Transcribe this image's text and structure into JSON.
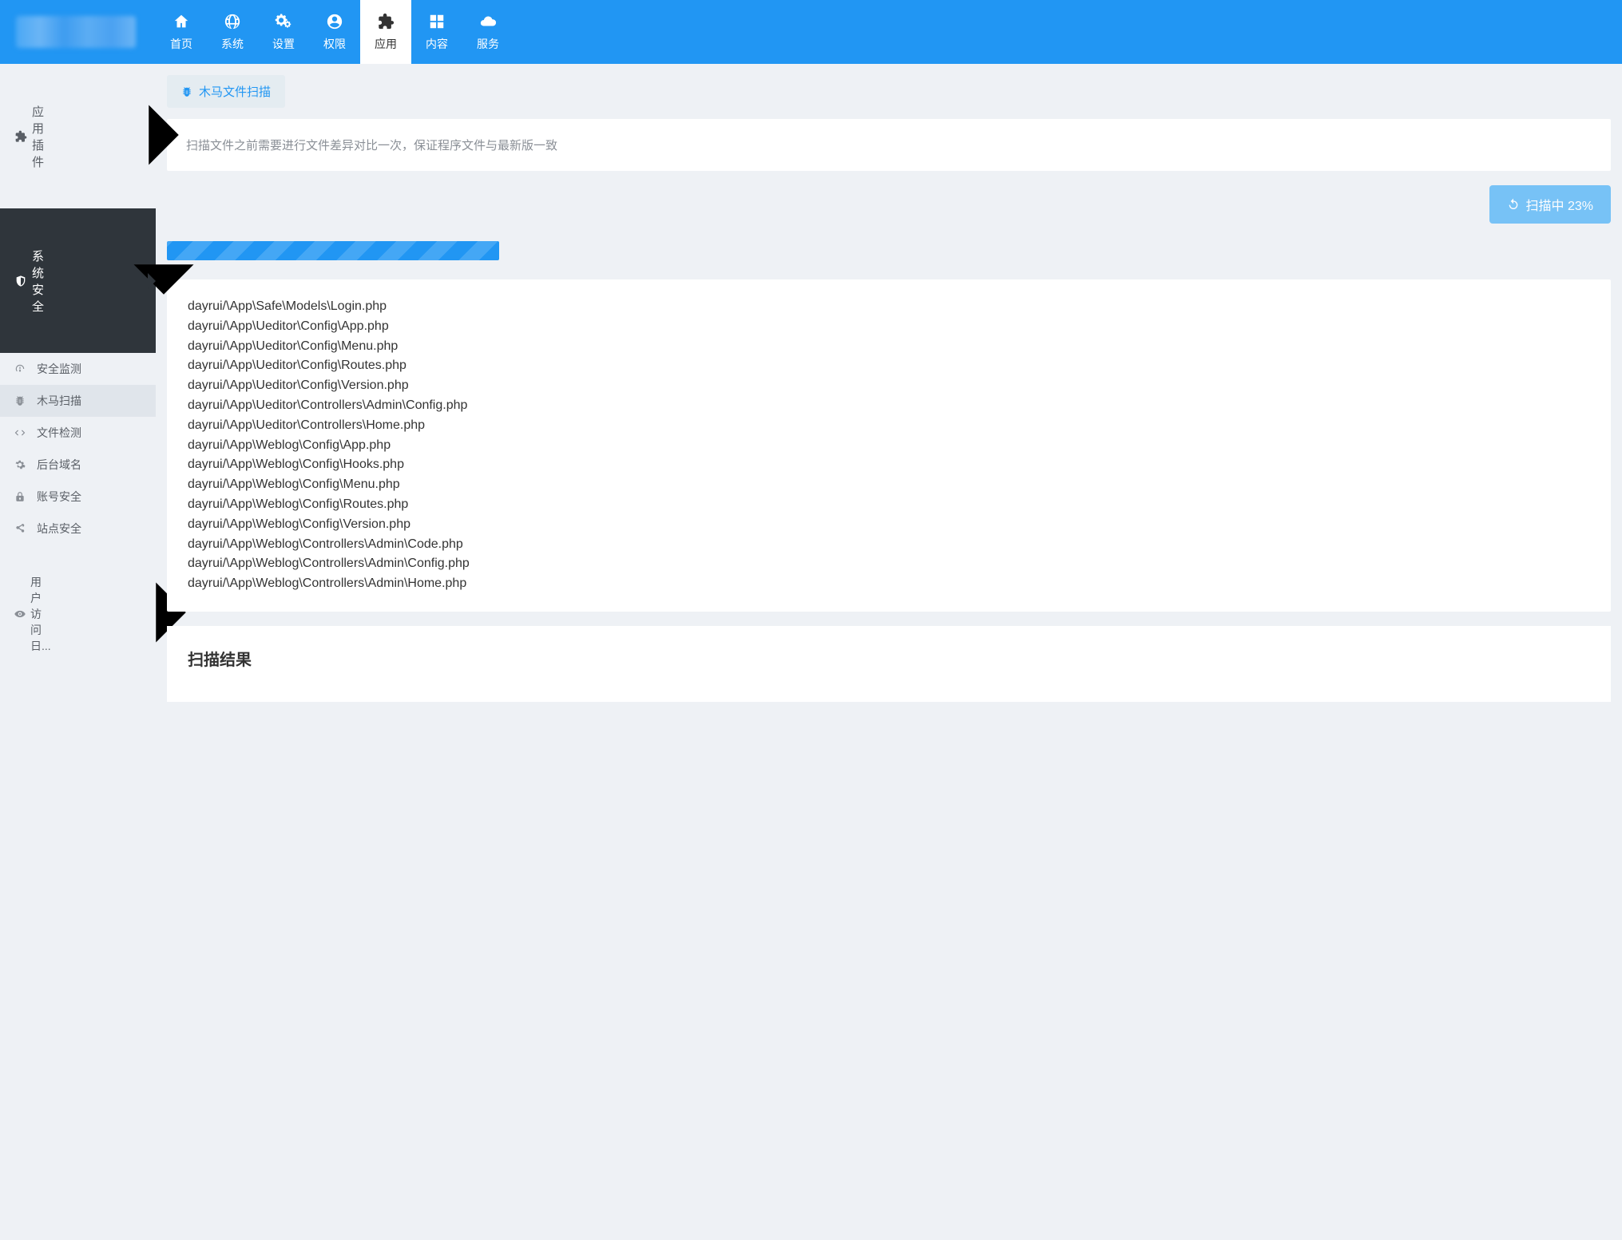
{
  "topnav": [
    {
      "label": "首页",
      "icon": "home"
    },
    {
      "label": "系统",
      "icon": "globe"
    },
    {
      "label": "设置",
      "icon": "gears"
    },
    {
      "label": "权限",
      "icon": "user-circle"
    },
    {
      "label": "应用",
      "icon": "puzzle",
      "active": true
    },
    {
      "label": "内容",
      "icon": "grid"
    },
    {
      "label": "服务",
      "icon": "cloud"
    }
  ],
  "sidebar": {
    "groups": [
      {
        "label": "应用插件",
        "icon": "puzzle",
        "chev": "right"
      },
      {
        "label": "系统安全",
        "icon": "shield",
        "chev": "down",
        "active": true
      }
    ],
    "subs": [
      {
        "label": "安全监测",
        "icon": "dashboard"
      },
      {
        "label": "木马扫描",
        "icon": "bug",
        "active": true
      },
      {
        "label": "文件检测",
        "icon": "code"
      },
      {
        "label": "后台域名",
        "icon": "gear"
      },
      {
        "label": "账号安全",
        "icon": "lock"
      },
      {
        "label": "站点安全",
        "icon": "share"
      },
      {
        "label": "用户访问日...",
        "icon": "eye",
        "chev": "right"
      }
    ]
  },
  "tab": {
    "label": "木马文件扫描",
    "icon": "bug"
  },
  "info_text": "扫描文件之前需要进行文件差异对比一次，保证程序文件与最新版一致",
  "scan_button": {
    "label": "扫描中 23%"
  },
  "progress_percent": 23,
  "files": [
    "dayrui/\\App\\Safe\\Models\\Login.php",
    "dayrui/\\App\\Ueditor\\Config\\App.php",
    "dayrui/\\App\\Ueditor\\Config\\Menu.php",
    "dayrui/\\App\\Ueditor\\Config\\Routes.php",
    "dayrui/\\App\\Ueditor\\Config\\Version.php",
    "dayrui/\\App\\Ueditor\\Controllers\\Admin\\Config.php",
    "dayrui/\\App\\Ueditor\\Controllers\\Home.php",
    "dayrui/\\App\\Weblog\\Config\\App.php",
    "dayrui/\\App\\Weblog\\Config\\Hooks.php",
    "dayrui/\\App\\Weblog\\Config\\Menu.php",
    "dayrui/\\App\\Weblog\\Config\\Routes.php",
    "dayrui/\\App\\Weblog\\Config\\Version.php",
    "dayrui/\\App\\Weblog\\Controllers\\Admin\\Code.php",
    "dayrui/\\App\\Weblog\\Controllers\\Admin\\Config.php",
    "dayrui/\\App\\Weblog\\Controllers\\Admin\\Home.php"
  ],
  "result_title": "扫描结果"
}
